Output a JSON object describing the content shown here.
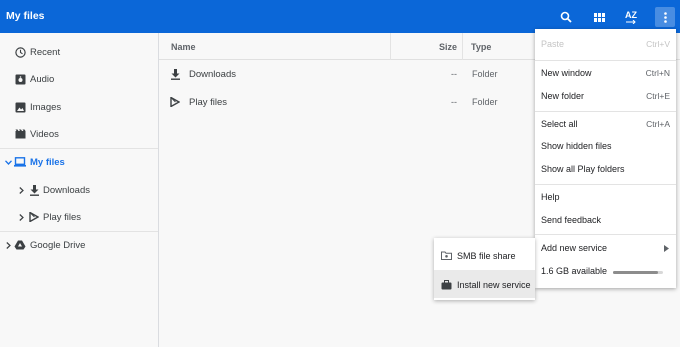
{
  "app": {
    "title": "My files"
  },
  "toolbar": {
    "search_icon": "search-icon",
    "grid_icon": "grid-view-icon",
    "sort_label": "AZ",
    "more_icon": "more-vert-icon"
  },
  "sidebar": {
    "items": [
      {
        "label": "Recent",
        "icon": "clock-icon"
      },
      {
        "label": "Audio",
        "icon": "audio-icon"
      },
      {
        "label": "Images",
        "icon": "image-icon"
      },
      {
        "label": "Videos",
        "icon": "video-icon"
      },
      {
        "label": "My files",
        "icon": "laptop-icon",
        "selected": true
      },
      {
        "label": "Downloads",
        "icon": "download-icon"
      },
      {
        "label": "Play files",
        "icon": "play-icon"
      },
      {
        "label": "Google Drive",
        "icon": "drive-icon"
      }
    ]
  },
  "columns": {
    "name": "Name",
    "size": "Size",
    "type": "Type"
  },
  "files": [
    {
      "name": "Downloads",
      "size": "--",
      "type": "Folder",
      "icon": "download-icon"
    },
    {
      "name": "Play files",
      "size": "--",
      "type": "Folder",
      "icon": "play-icon"
    }
  ],
  "menu": {
    "paste": {
      "label": "Paste",
      "shortcut": "Ctrl+V"
    },
    "new_window": {
      "label": "New window",
      "shortcut": "Ctrl+N"
    },
    "new_folder": {
      "label": "New folder",
      "shortcut": "Ctrl+E"
    },
    "select_all": {
      "label": "Select all",
      "shortcut": "Ctrl+A"
    },
    "show_hidden": {
      "label": "Show hidden files"
    },
    "show_play": {
      "label": "Show all Play folders"
    },
    "help": {
      "label": "Help"
    },
    "feedback": {
      "label": "Send feedback"
    },
    "add_service": {
      "label": "Add new service"
    },
    "storage": {
      "label": "1.6 GB available",
      "used_fraction": 0.9
    }
  },
  "submenu": {
    "smb": {
      "label": "SMB file share",
      "icon": "smb-icon"
    },
    "install": {
      "label": "Install new service",
      "icon": "briefcase-icon"
    }
  },
  "colors": {
    "accent": "#0b67d8",
    "selected_text": "#1a73e8"
  }
}
